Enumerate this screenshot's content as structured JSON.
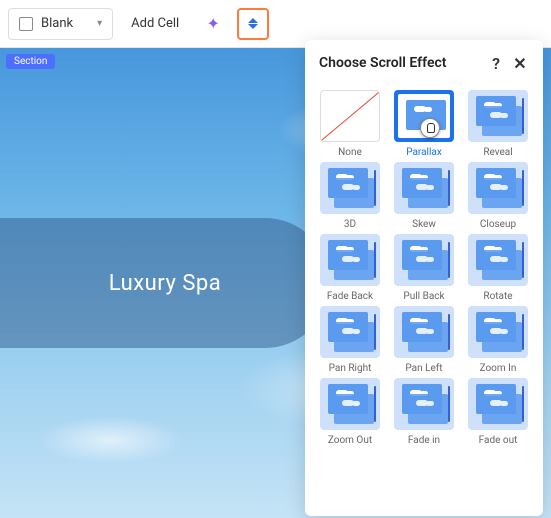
{
  "toolbar": {
    "blank_label": "Blank",
    "add_cell_label": "Add Cell"
  },
  "section_tag": "Section",
  "hero_title": "Luxury Spa",
  "panel": {
    "title": "Choose Scroll Effect",
    "help": "?",
    "close": "✕",
    "options": [
      {
        "label": "None",
        "kind": "none"
      },
      {
        "label": "Parallax",
        "kind": "sel"
      },
      {
        "label": "Reveal",
        "kind": "std"
      },
      {
        "label": "3D",
        "kind": "std"
      },
      {
        "label": "Skew",
        "kind": "std"
      },
      {
        "label": "Closeup",
        "kind": "std"
      },
      {
        "label": "Fade Back",
        "kind": "std"
      },
      {
        "label": "Pull Back",
        "kind": "std"
      },
      {
        "label": "Rotate",
        "kind": "std"
      },
      {
        "label": "Pan Right",
        "kind": "std"
      },
      {
        "label": "Pan Left",
        "kind": "std"
      },
      {
        "label": "Zoom In",
        "kind": "std"
      },
      {
        "label": "Zoom Out",
        "kind": "std"
      },
      {
        "label": "Fade in",
        "kind": "std"
      },
      {
        "label": "Fade out",
        "kind": "std"
      }
    ]
  }
}
